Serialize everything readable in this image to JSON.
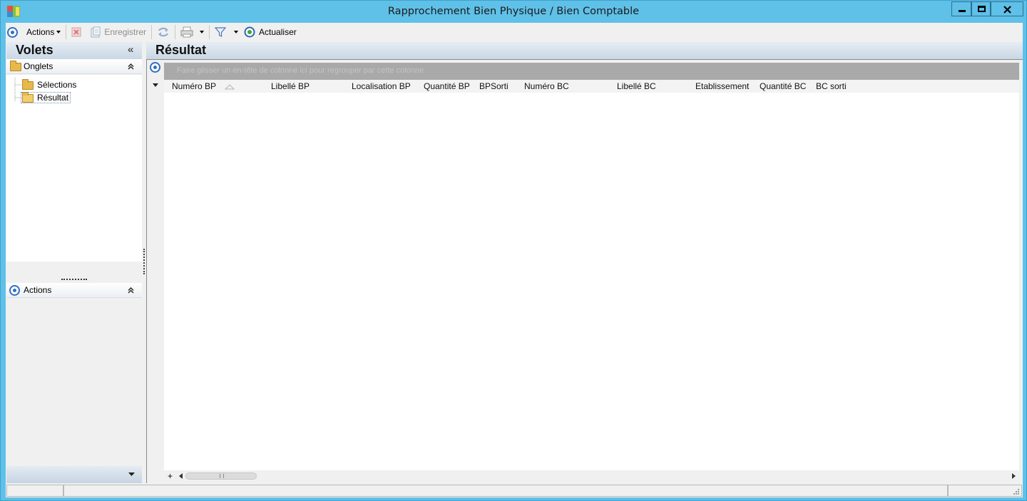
{
  "window": {
    "title": "Rapprochement Bien Physique / Bien Comptable",
    "accent": "#5fc0e8"
  },
  "toolbar": {
    "actions_label": "Actions",
    "save_label": "Enregistrer",
    "refresh_label": "Actualiser"
  },
  "left_pane": {
    "title": "Volets",
    "tabs_group": {
      "label": "Onglets",
      "items": [
        {
          "label": "Sélections"
        },
        {
          "label": "Résultat"
        }
      ]
    },
    "actions_group": {
      "label": "Actions"
    }
  },
  "result": {
    "title": "Résultat",
    "group_panel_hint": "Faire glisser un en-tête de colonne ici pour regrouper par cette colonne",
    "columns": [
      {
        "label": "Numéro BP"
      },
      {
        "label": "Libellé BP"
      },
      {
        "label": "Localisation BP"
      },
      {
        "label": "Quantité BP"
      },
      {
        "label": "BPSorti"
      },
      {
        "label": "Numéro BC"
      },
      {
        "label": "Libellé BC"
      },
      {
        "label": "Etablissement"
      },
      {
        "label": "Quantité BC"
      },
      {
        "label": "BC sorti"
      }
    ]
  }
}
